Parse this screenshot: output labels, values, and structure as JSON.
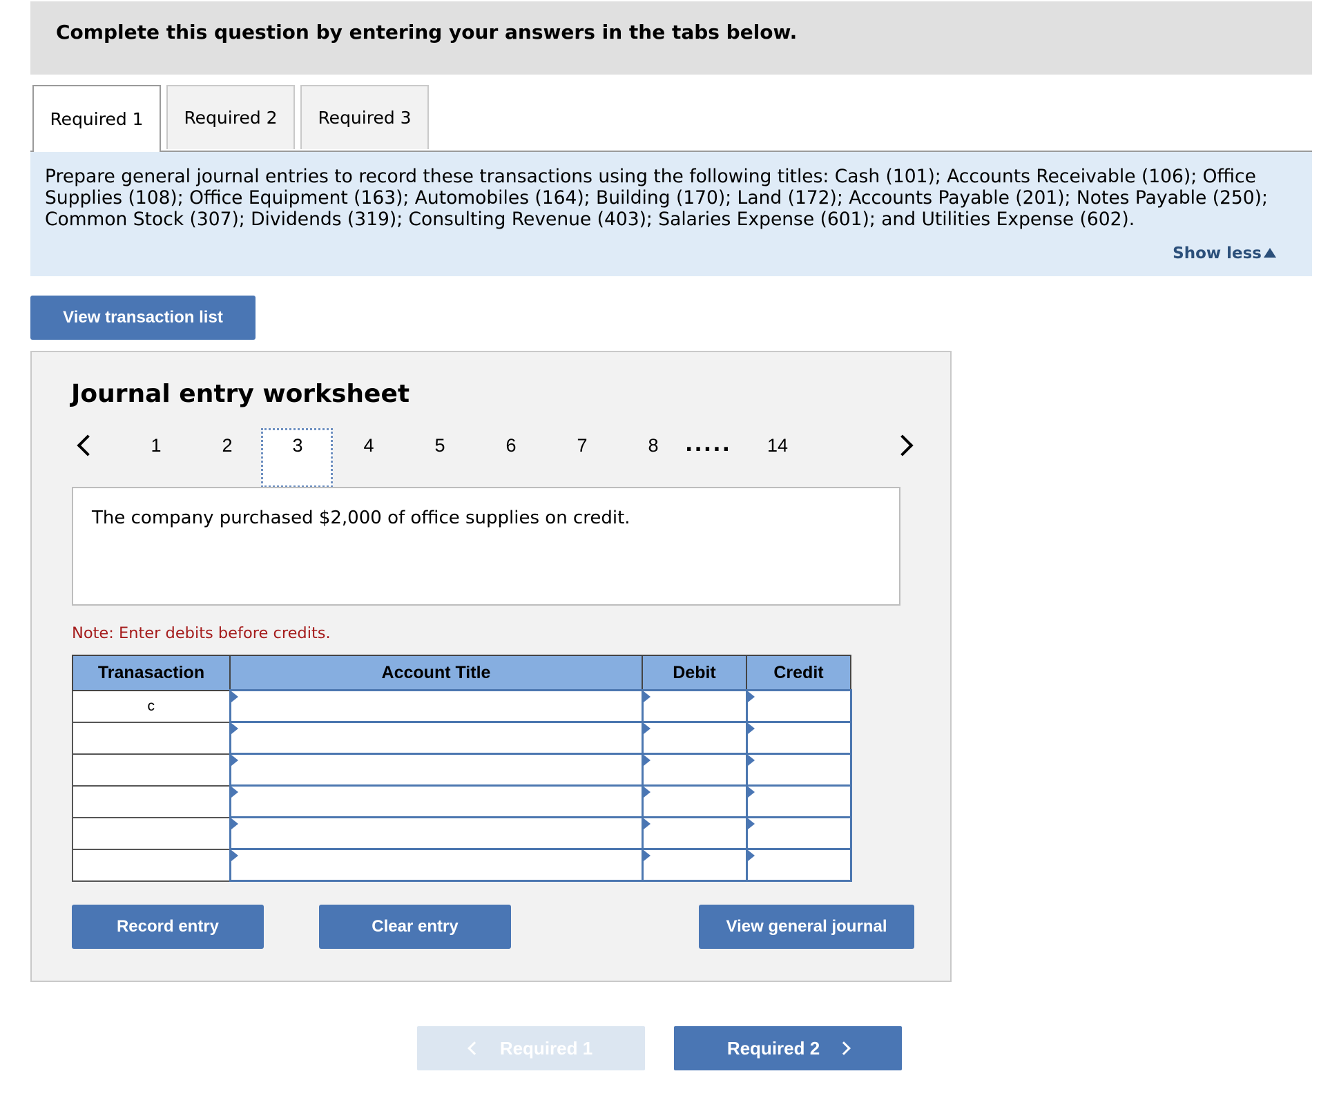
{
  "banner": {
    "text": "Complete this question by entering your answers in the tabs below."
  },
  "tabs": [
    {
      "label": "Required 1",
      "active": true
    },
    {
      "label": "Required 2",
      "active": false
    },
    {
      "label": "Required 3",
      "active": false
    }
  ],
  "instructions": {
    "text": "Prepare general journal entries to record these transactions using the following titles: Cash (101); Accounts Receivable (106); Office Supplies (108); Office Equipment (163); Automobiles (164); Building (170); Land (172); Accounts Payable (201); Notes Payable (250); Common Stock (307); Dividends (319); Consulting Revenue (403); Salaries Expense (601); and Utilities Expense (602).",
    "show_less_label": "Show less"
  },
  "view_transaction_list_label": "View transaction list",
  "worksheet": {
    "title": "Journal entry worksheet",
    "pages": [
      "1",
      "2",
      "3",
      "4",
      "5",
      "6",
      "7",
      "8"
    ],
    "selected_page": "3",
    "ellipsis": ".....",
    "last_page": "14",
    "description": "The company purchased $2,000 of office supplies on credit.",
    "note": "Note: Enter debits before credits.",
    "table": {
      "headers": {
        "transaction": "Tranasaction",
        "account": "Account Title",
        "debit": "Debit",
        "credit": "Credit"
      },
      "rows": [
        {
          "transaction": "c",
          "account": "",
          "debit": "",
          "credit": ""
        },
        {
          "transaction": "",
          "account": "",
          "debit": "",
          "credit": ""
        },
        {
          "transaction": "",
          "account": "",
          "debit": "",
          "credit": ""
        },
        {
          "transaction": "",
          "account": "",
          "debit": "",
          "credit": ""
        },
        {
          "transaction": "",
          "account": "",
          "debit": "",
          "credit": ""
        },
        {
          "transaction": "",
          "account": "",
          "debit": "",
          "credit": ""
        }
      ]
    },
    "buttons": {
      "record": "Record entry",
      "clear": "Clear entry",
      "view_journal": "View general journal"
    }
  },
  "nav": {
    "prev_label": "Required 1",
    "next_label": "Required 2"
  },
  "colors": {
    "accent": "#4a76b4",
    "header_fill": "#86aee0",
    "instructions_bg": "#dfebf7",
    "note": "#a51c1c",
    "link": "#2b4f7a"
  }
}
